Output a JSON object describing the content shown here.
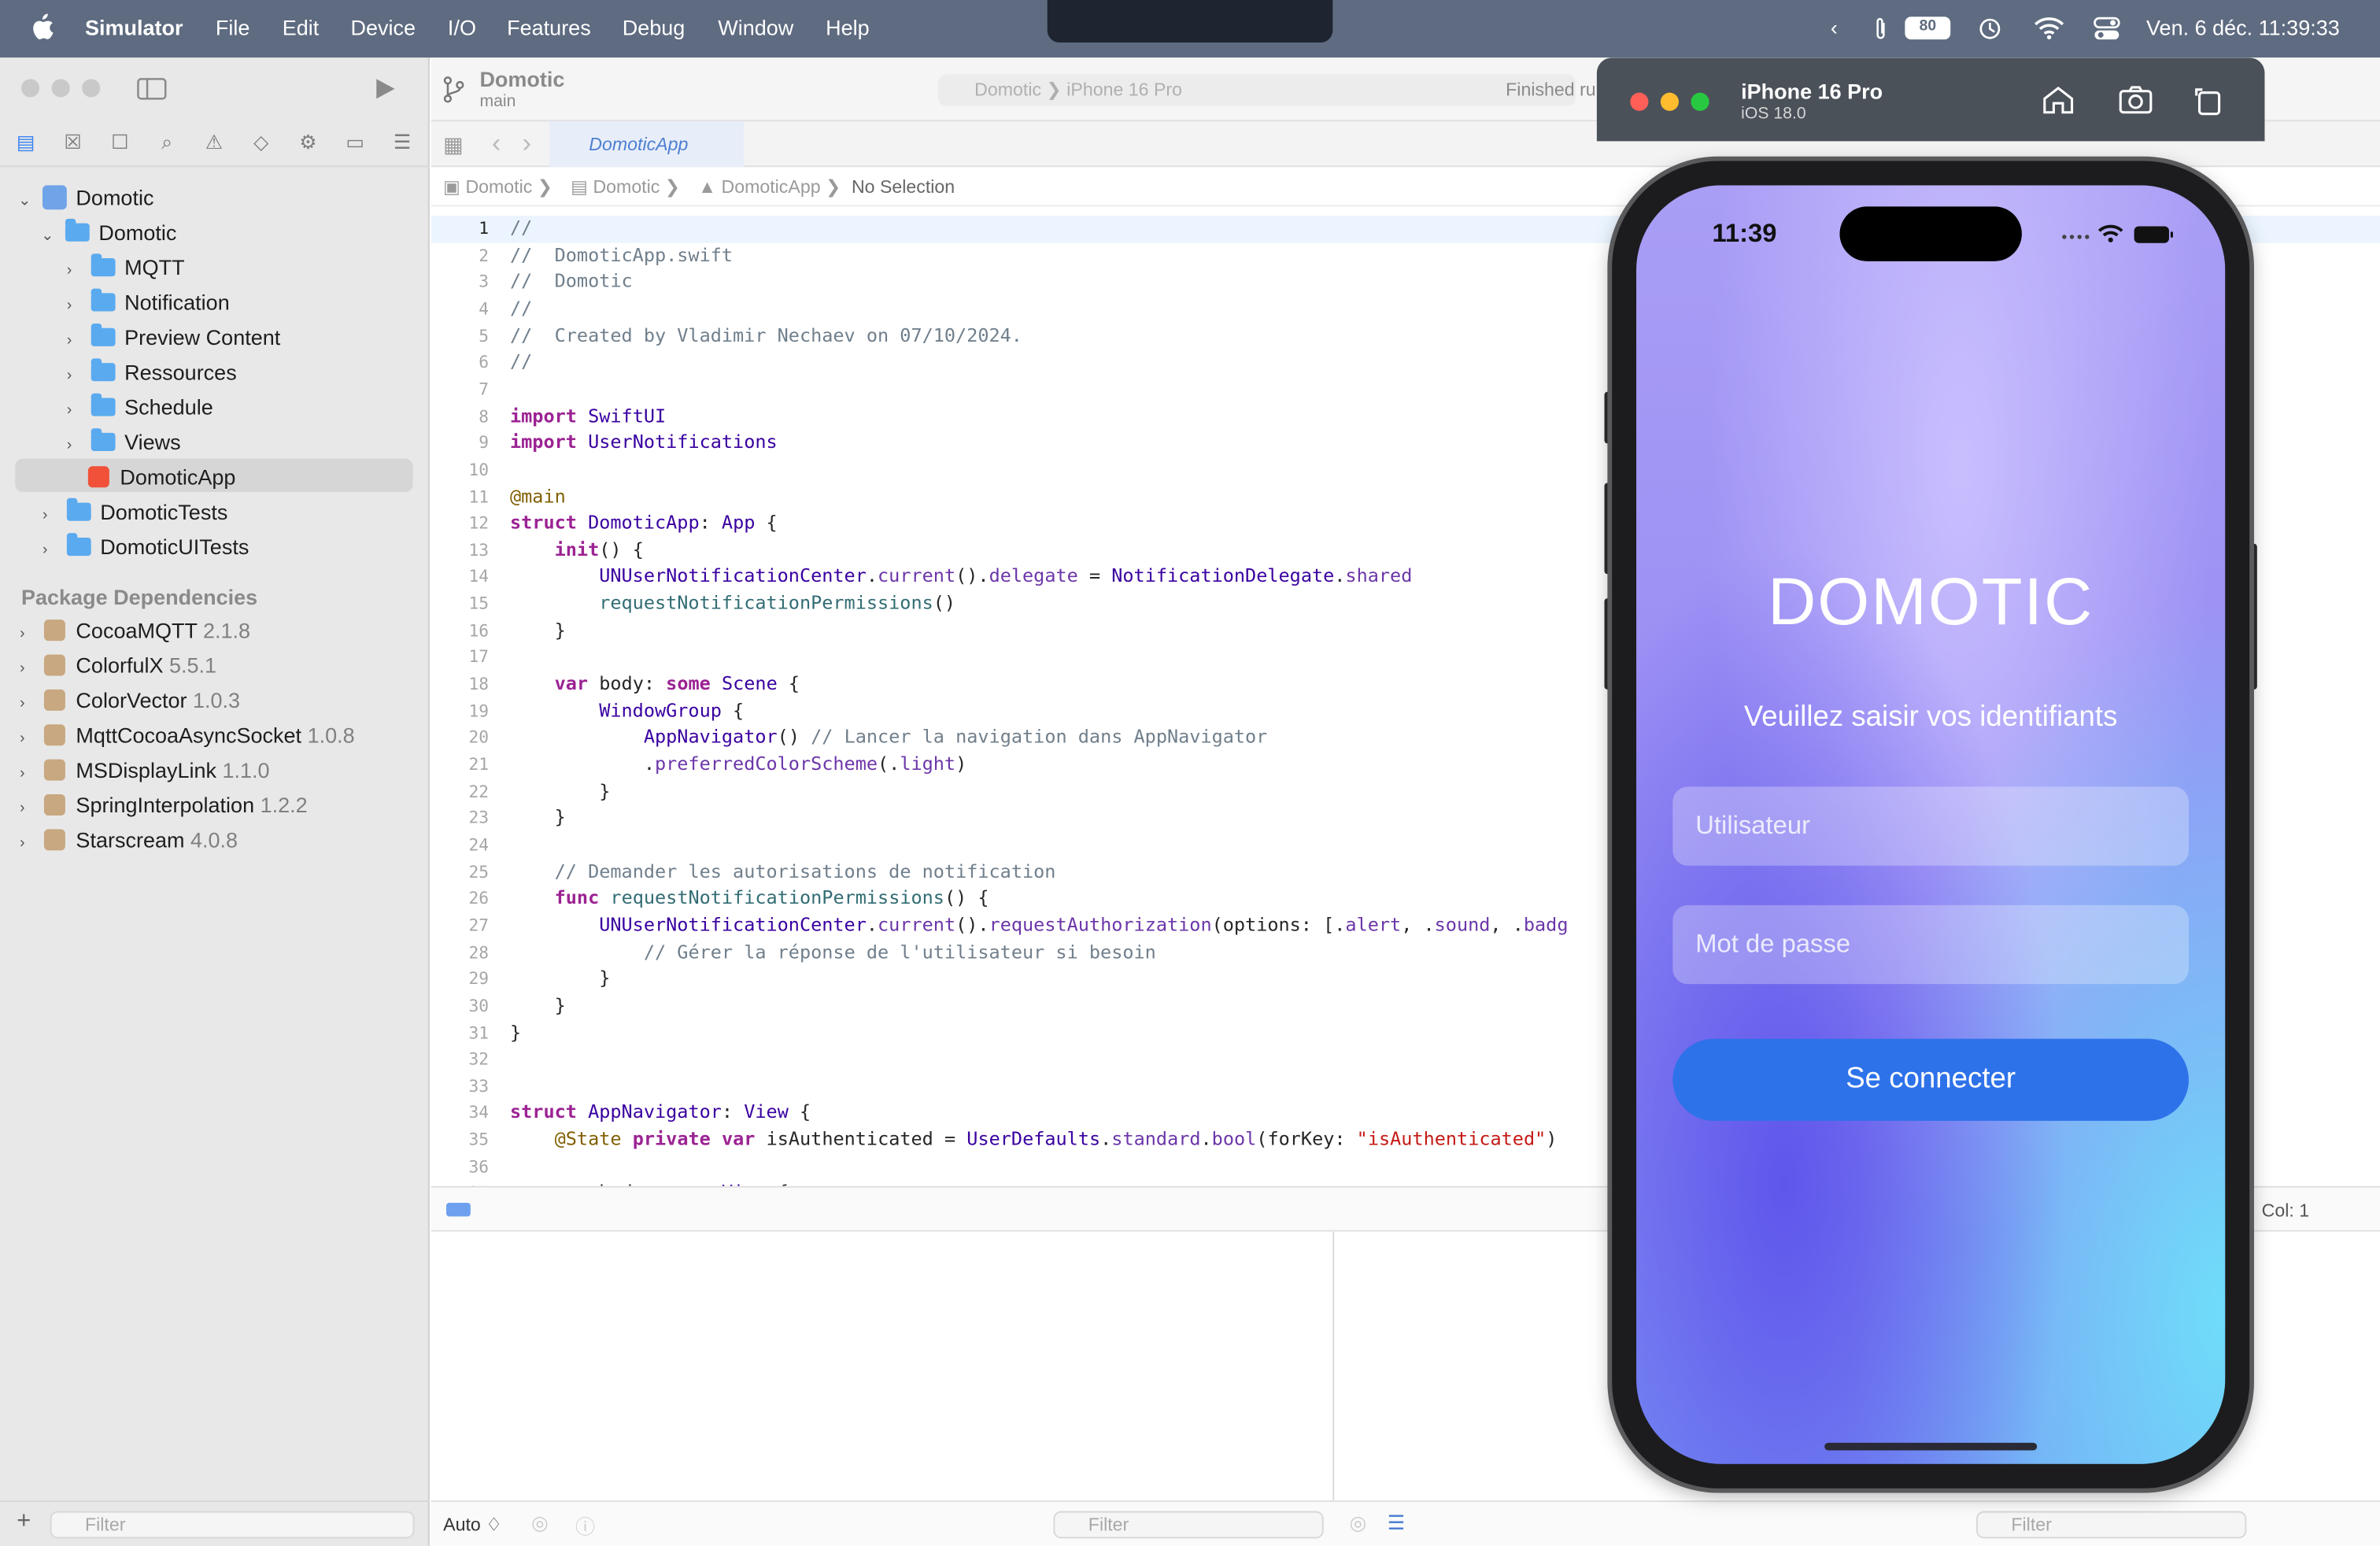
{
  "menubar": {
    "app": "Simulator",
    "items": [
      "File",
      "Edit",
      "Device",
      "I/O",
      "Features",
      "Debug",
      "Window",
      "Help"
    ],
    "battery": "80",
    "datetime": "Ven. 6 déc.  11:39:33"
  },
  "toolbar": {
    "scheme": "Domotic",
    "branch": "main",
    "destination": "Domotic  ❯  iPhone 16 Pro",
    "status": "Finished ru"
  },
  "tab": {
    "label": "DomoticApp"
  },
  "breadcrumb": [
    "Domotic",
    "Domotic",
    "DomoticApp",
    "No Selection"
  ],
  "navigator": {
    "root": "Domotic",
    "group": "Domotic",
    "folders": [
      "MQTT",
      "Notification",
      "Preview Content",
      "Ressources",
      "Schedule",
      "Views"
    ],
    "file": "DomoticApp",
    "targets": [
      "DomoticTests",
      "DomoticUITests"
    ],
    "packages_header": "Package Dependencies",
    "packages": [
      {
        "name": "CocoaMQTT",
        "version": "2.1.8"
      },
      {
        "name": "ColorfulX",
        "version": "5.5.1"
      },
      {
        "name": "ColorVector",
        "version": "1.0.3"
      },
      {
        "name": "MqttCocoaAsyncSocket",
        "version": "1.0.8"
      },
      {
        "name": "MSDisplayLink",
        "version": "1.1.0"
      },
      {
        "name": "SpringInterpolation",
        "version": "1.2.2"
      },
      {
        "name": "Starscream",
        "version": "4.0.8"
      }
    ],
    "filter_placeholder": "Filter"
  },
  "code_lines": [
    "//",
    "//  DomoticApp.swift",
    "//  Domotic",
    "//",
    "//  Created by Vladimir Nechaev on 07/10/2024.",
    "//",
    "",
    "import SwiftUI",
    "import UserNotifications",
    "",
    "@main",
    "struct DomoticApp: App {",
    "    init() {",
    "        UNUserNotificationCenter.current().delegate = NotificationDelegate.shared",
    "        requestNotificationPermissions()",
    "    }",
    "",
    "    var body: some Scene {",
    "        WindowGroup {",
    "            AppNavigator() // Lancer la navigation dans AppNavigator",
    "            .preferredColorScheme(.light)",
    "        }",
    "    }",
    "",
    "    // Demander les autorisations de notification",
    "    func requestNotificationPermissions() {",
    "        UNUserNotificationCenter.current().requestAuthorization(options: [.alert, .sound, .badg",
    "            // Gérer la réponse de l'utilisateur si besoin",
    "        }",
    "    }",
    "}",
    "",
    "",
    "struct AppNavigator: View {",
    "    @State private var isAuthenticated = UserDefaults.standard.bool(forKey: \"isAuthenticated\")",
    "",
    "    var body: some View {"
  ],
  "debug": {
    "col": "Col: 1",
    "auto": "Auto ♢",
    "filter": "Filter"
  },
  "simulator": {
    "device": "iPhone 16 Pro",
    "os": "iOS 18.0",
    "status_time": "11:39",
    "app_title": "DOMOTIC",
    "app_subtitle": "Veuillez saisir vos identifiants",
    "username_placeholder": "Utilisateur",
    "password_placeholder": "Mot de passe",
    "login_label": "Se connecter"
  },
  "colors": {
    "menubar": "#5e6b80",
    "accent": "#2e72ea",
    "keyword": "#9b2393",
    "comment": "#707f8c"
  }
}
